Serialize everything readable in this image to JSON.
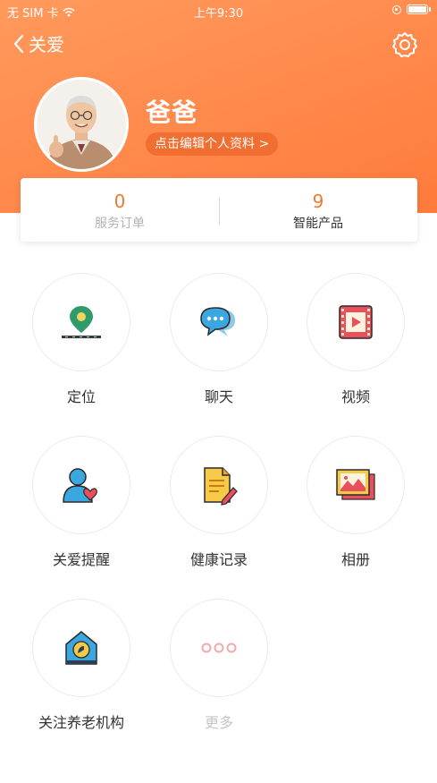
{
  "status_bar": {
    "carrier": "无 SIM 卡",
    "time": "上午9:30"
  },
  "nav": {
    "back_label": "关爱"
  },
  "profile": {
    "name": "爸爸",
    "edit_label": "点击编辑个人资料 >"
  },
  "stats": [
    {
      "value": "0",
      "label": "服务订单"
    },
    {
      "value": "9",
      "label": "智能产品"
    }
  ],
  "grid": [
    {
      "label": "定位",
      "icon": "location-pin-icon"
    },
    {
      "label": "聊天",
      "icon": "chat-bubble-icon"
    },
    {
      "label": "视频",
      "icon": "video-film-icon"
    },
    {
      "label": "关爱提醒",
      "icon": "care-reminder-icon"
    },
    {
      "label": "健康记录",
      "icon": "health-record-icon"
    },
    {
      "label": "相册",
      "icon": "photo-album-icon"
    },
    {
      "label": "关注养老机构",
      "icon": "nursing-home-icon"
    },
    {
      "label": "更多",
      "icon": "more-dots-icon"
    }
  ],
  "colors": {
    "accent": "#ff7a3c",
    "stat_number": "#f07a30"
  }
}
